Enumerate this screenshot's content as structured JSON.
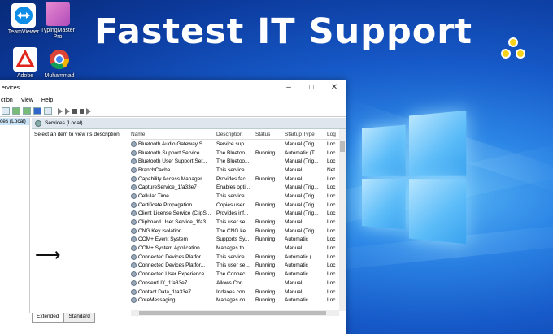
{
  "headline": "Fastest IT Support",
  "desktop_icons": [
    {
      "label": "TeamViewer",
      "icon": "teamviewer-icon"
    },
    {
      "label": "TypingMaster Pro",
      "icon": "typingmaster-icon"
    },
    {
      "label": "Adobe",
      "icon": "adobe-icon"
    },
    {
      "label": "Muhammad",
      "icon": "chrome-icon"
    }
  ],
  "window": {
    "title": "ervices",
    "menu": [
      "ction",
      "View",
      "Help"
    ],
    "left_panel_item": "ces (Local)",
    "services_header": "Services (Local)",
    "description_hint": "Select an item to view its description.",
    "columns": [
      "Name",
      "Description",
      "Status",
      "Startup Type",
      "Log"
    ],
    "rows": [
      [
        "Bluetooth Audio Gateway S...",
        "Service sup...",
        "",
        "Manual (Trig...",
        "Loc"
      ],
      [
        "Bluetooth Support Service",
        "The Bluetoo...",
        "Running",
        "Automatic (T...",
        "Loc"
      ],
      [
        "Bluetooth User Support Ser...",
        "The Bluetoo...",
        "",
        "Manual (Trig...",
        "Loc"
      ],
      [
        "BranchCache",
        "This service ...",
        "",
        "Manual",
        "Net"
      ],
      [
        "Capability Access Manager ...",
        "Provides fac...",
        "Running",
        "Manual",
        "Loc"
      ],
      [
        "CaptureService_1fa33e7",
        "Enables opti...",
        "",
        "Manual (Trig...",
        "Loc"
      ],
      [
        "Cellular Time",
        "This service ...",
        "",
        "Manual (Trig...",
        "Loc"
      ],
      [
        "Certificate Propagation",
        "Copies user ...",
        "Running",
        "Manual (Trig...",
        "Loc"
      ],
      [
        "Client License Service (ClipS...",
        "Provides inf...",
        "",
        "Manual (Trig...",
        "Loc"
      ],
      [
        "Clipboard User Service_1fa3...",
        "This user se...",
        "Running",
        "Manual",
        "Loc"
      ],
      [
        "CNG Key Isolation",
        "The CNG ke...",
        "Running",
        "Manual (Trig...",
        "Loc"
      ],
      [
        "COM+ Event System",
        "Supports Sy...",
        "Running",
        "Automatic",
        "Loc"
      ],
      [
        "COM+ System Application",
        "Manages th...",
        "",
        "Manual",
        "Loc"
      ],
      [
        "Connected Devices Platfor...",
        "This service ...",
        "Running",
        "Automatic (...",
        "Loc"
      ],
      [
        "Connected Devices Platfor...",
        "This user se...",
        "Running",
        "Automatic",
        "Loc"
      ],
      [
        "Connected User Experience...",
        "The Connec...",
        "Running",
        "Automatic",
        "Loc"
      ],
      [
        "ConsentUX_1fa33e7",
        "Allows Con...",
        "",
        "Manual",
        "Loc"
      ],
      [
        "Contact Data_1fa33e7",
        "Indexes con...",
        "Running",
        "Manual",
        "Loc"
      ],
      [
        "CoreMessaging",
        "Manages co...",
        "Running",
        "Automatic",
        "Loc"
      ]
    ],
    "tabs": [
      "Extended",
      "Standard"
    ]
  },
  "colors": {
    "accent": "#f7d21a",
    "desktop": "#1659c8"
  }
}
